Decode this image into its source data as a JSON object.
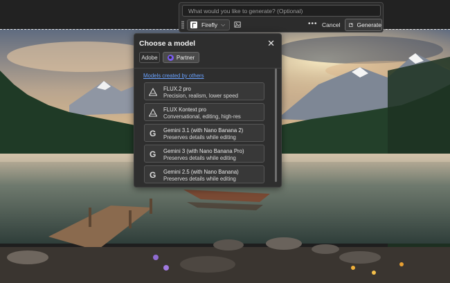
{
  "generate_bar": {
    "prompt_placeholder": "What would you like to generate? (Optional)",
    "model_label": "Firefly",
    "more_label": "•••",
    "cancel_label": "Cancel",
    "generate_label": "Generate"
  },
  "model_panel": {
    "title": "Choose a model",
    "tabs": [
      {
        "label": "Adobe",
        "selected": false
      },
      {
        "label": "Partner",
        "selected": true
      }
    ],
    "section_label": "Models created by others",
    "models": [
      {
        "icon": "bfl-icon",
        "name": "FLUX.2 pro",
        "description": "Precision, realism, lower speed"
      },
      {
        "icon": "bfl-icon",
        "name": "FLUX Kontext pro",
        "description": "Conversational, editing, high-res"
      },
      {
        "icon": "google-icon",
        "name": "Gemini 3.1 (with Nano Banana 2)",
        "description": "Preserves details while editing"
      },
      {
        "icon": "google-icon",
        "name": "Gemini 3 (with Nano Banana Pro)",
        "description": "Preserves details while editing"
      },
      {
        "icon": "google-icon",
        "name": "Gemini 2.5 (with Nano Banana)",
        "description": "Preserves details while editing"
      }
    ]
  },
  "colors": {
    "panel_bg": "#2e2e2e",
    "link": "#6aa2ff",
    "partner_accent": "#7a5cf0"
  }
}
